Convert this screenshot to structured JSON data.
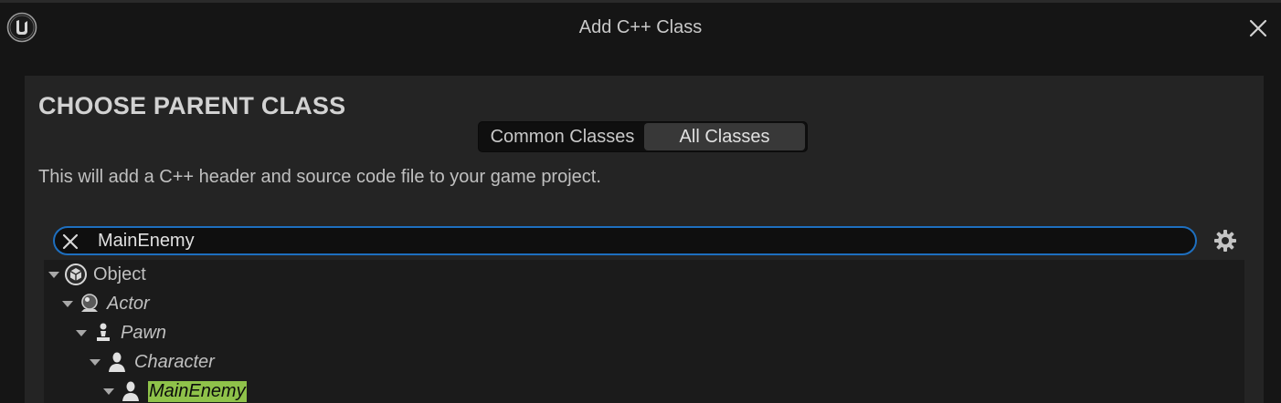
{
  "window": {
    "title": "Add C++ Class"
  },
  "panel": {
    "heading": "CHOOSE PARENT CLASS",
    "tabs": [
      {
        "label": "Common Classes",
        "selected": false
      },
      {
        "label": "All Classes",
        "selected": true
      }
    ],
    "description": "This will add a C++ header and source code file to your game project."
  },
  "search": {
    "value": "MainEnemy",
    "placeholder": ""
  },
  "tree": {
    "nodes": [
      {
        "label": "Object",
        "depth": 0,
        "expanded": true,
        "icon": "object-icon"
      },
      {
        "label": "Actor",
        "depth": 1,
        "expanded": true,
        "icon": "actor-icon"
      },
      {
        "label": "Pawn",
        "depth": 2,
        "expanded": true,
        "icon": "pawn-icon"
      },
      {
        "label": "Character",
        "depth": 3,
        "expanded": true,
        "icon": "character-icon"
      },
      {
        "label": "MainEnemy",
        "depth": 4,
        "expanded": true,
        "icon": "character-icon",
        "highlighted": true
      }
    ]
  },
  "colors": {
    "accent": "#1e6fbf",
    "highlight": "#8fc24a"
  }
}
